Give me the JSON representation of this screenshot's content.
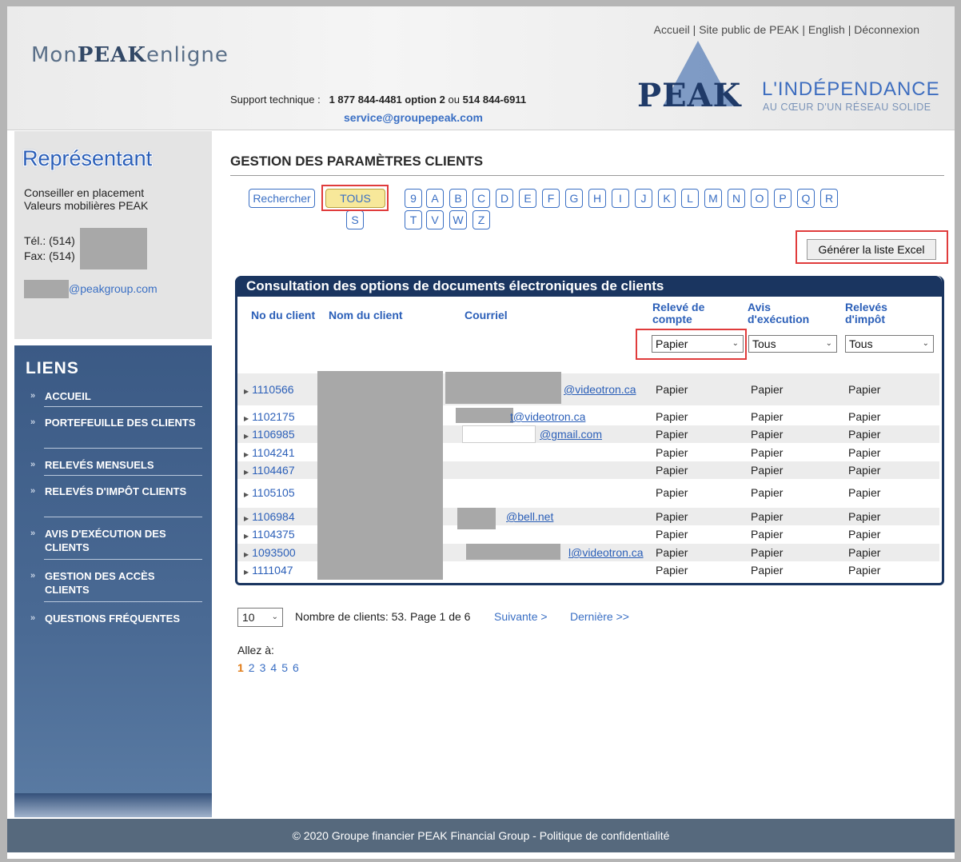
{
  "header": {
    "logo_pre": "Mon",
    "logo_bold": "PEAK",
    "logo_post": "enligne",
    "topnav": [
      "Accueil",
      "Site public de PEAK",
      "English",
      "Déconnexion"
    ],
    "topnav_sep": "|",
    "support_label": "Support technique :",
    "support_num1": "1 877 844-4481 option 2",
    "support_or": "ou",
    "support_num2": "514 844-6911",
    "support_email": "service@groupepeak.com",
    "brand_word": "PEAK",
    "brand_tag1": "L'INDÉPENDANCE",
    "brand_tag2": "AU CŒUR D'UN RÉSEAU SOLIDE"
  },
  "sidebar": {
    "rep_title": "Représentant",
    "rep_line1": "Conseiller en placement",
    "rep_line2": "Valeurs mobilières PEAK",
    "tel": "Tél.: (514)",
    "fax": "Fax: (514)",
    "email": "@peakgroup.com",
    "links_title": "LIENS",
    "links": [
      "ACCUEIL",
      "PORTEFEUILLE DES CLIENTS",
      "RELEVÉS MENSUELS",
      "RELEVÉS D'IMPÔT CLIENTS",
      "AVIS D'EXÉCUTION DES CLIENTS",
      "GESTION DES ACCÈS CLIENTS",
      "QUESTIONS FRÉQUENTES"
    ]
  },
  "main": {
    "title": "GESTION DES PARAMÈTRES CLIENTS",
    "search_label": "Rechercher",
    "all_label": "TOUS",
    "letters_row1": [
      "9",
      "A",
      "B",
      "C",
      "D",
      "E",
      "F",
      "G",
      "H",
      "I",
      "J",
      "K",
      "L",
      "M",
      "N",
      "O",
      "P",
      "Q",
      "R"
    ],
    "letters_row2": [
      "S",
      "T",
      "V",
      "W",
      "Z"
    ],
    "excel_label": "Générer la liste Excel",
    "table_caption": "Consultation des options de documents électroniques de clients",
    "headers": {
      "id": "No du client",
      "name": "Nom du client",
      "email": "Courriel",
      "releve_l1": "Relevé de",
      "releve_l2": "compte",
      "avis_l1": "Avis",
      "avis_l2": "d'exécution",
      "impot_l1": "Relevés",
      "impot_l2": "d'impôt"
    },
    "filters": {
      "releve": "Papier",
      "avis": "Tous",
      "impot": "Tous"
    },
    "rows": [
      {
        "id": "1110566",
        "email": "@videotron.ca",
        "releve": "Papier",
        "avis": "Papier",
        "impot": "Papier"
      },
      {
        "id": "1102175",
        "email": "t@videotron.ca",
        "releve": "Papier",
        "avis": "Papier",
        "impot": "Papier"
      },
      {
        "id": "1106985",
        "email": "@gmail.com",
        "releve": "Papier",
        "avis": "Papier",
        "impot": "Papier"
      },
      {
        "id": "1104241",
        "email": "",
        "releve": "Papier",
        "avis": "Papier",
        "impot": "Papier"
      },
      {
        "id": "1104467",
        "email": "",
        "releve": "Papier",
        "avis": "Papier",
        "impot": "Papier"
      },
      {
        "id": "1105105",
        "email": "",
        "releve": "Papier",
        "avis": "Papier",
        "impot": "Papier"
      },
      {
        "id": "1106984",
        "email": "@bell.net",
        "releve": "Papier",
        "avis": "Papier",
        "impot": "Papier"
      },
      {
        "id": "1104375",
        "email": "",
        "releve": "Papier",
        "avis": "Papier",
        "impot": "Papier"
      },
      {
        "id": "1093500",
        "email": "l@videotron.ca",
        "releve": "Papier",
        "avis": "Papier",
        "impot": "Papier"
      },
      {
        "id": "1111047",
        "email": "",
        "releve": "Papier",
        "avis": "Papier",
        "impot": "Papier"
      }
    ],
    "pager": {
      "per_page": "10",
      "summary": "Nombre de clients: 53. Page 1 de 6",
      "next": "Suivante >",
      "last": "Dernière >>",
      "goto_label": "Allez à:",
      "pages": [
        "1",
        "2",
        "3",
        "4",
        "5",
        "6"
      ],
      "current": "1"
    }
  },
  "footer": {
    "text": "© 2020 Groupe financier PEAK Financial Group - Politique de confidentialité"
  }
}
